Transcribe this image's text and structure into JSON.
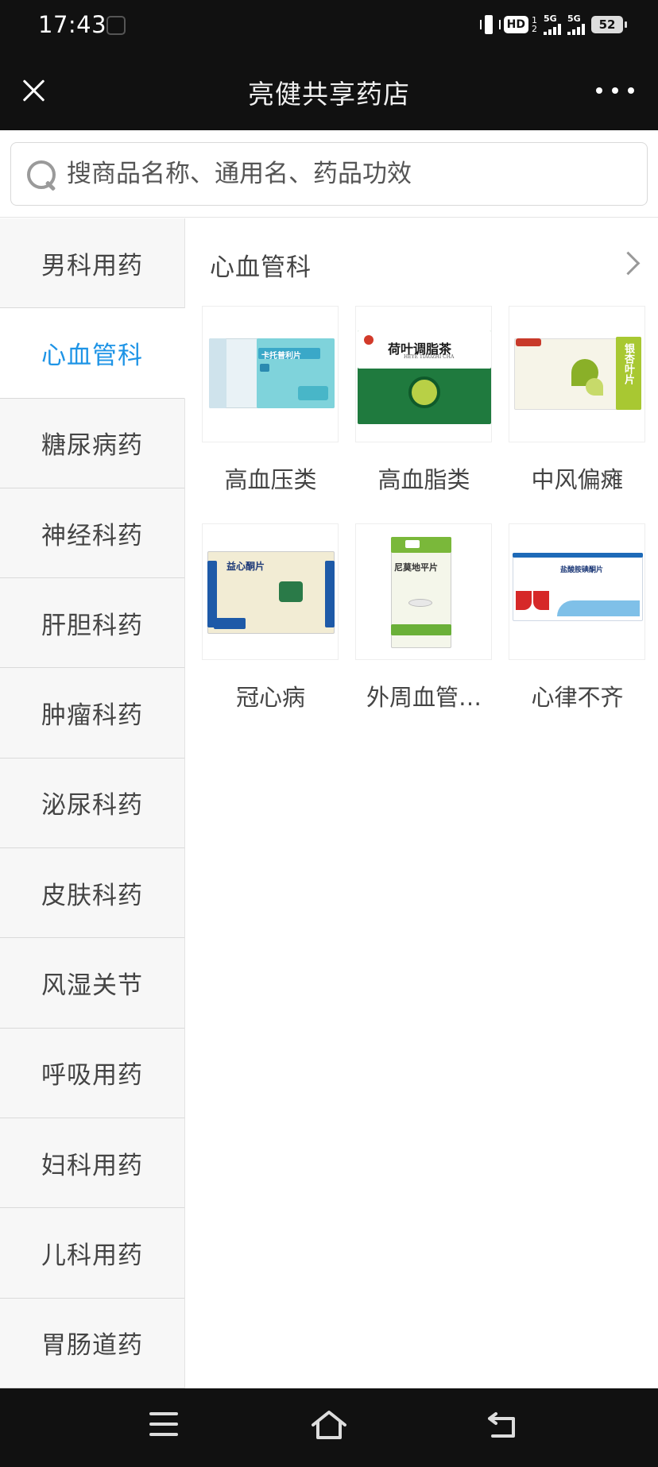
{
  "status_bar": {
    "time": "17:43",
    "hd_label": "HD",
    "hd_sup": "1",
    "hd_sub": "2",
    "sig1_label": "5G",
    "sig2_label": "5G",
    "battery": "52"
  },
  "header": {
    "title": "亮健共享药店",
    "close_icon": "close-icon",
    "more_icon": "more-icon"
  },
  "search": {
    "placeholder": "搜商品名称、通用名、药品功效"
  },
  "sidebar": {
    "items": [
      {
        "label": "男科用药"
      },
      {
        "label": "心血管科"
      },
      {
        "label": "糖尿病药"
      },
      {
        "label": "神经科药"
      },
      {
        "label": "肝胆科药"
      },
      {
        "label": "肿瘤科药"
      },
      {
        "label": "泌尿科药"
      },
      {
        "label": "皮肤科药"
      },
      {
        "label": "风湿关节"
      },
      {
        "label": "呼吸用药"
      },
      {
        "label": "妇科用药"
      },
      {
        "label": "儿科用药"
      },
      {
        "label": "胃肠道药"
      }
    ],
    "active_index": 1
  },
  "content": {
    "section_title": "心血管科",
    "categories": [
      {
        "label": "高血压类",
        "box_text": "卡托普利片"
      },
      {
        "label": "高血脂类",
        "box_text": "荷叶调脂茶",
        "box_subtext": "HEYE TIAOZHI CHA"
      },
      {
        "label": "中风偏瘫",
        "box_text": "银杏叶片"
      },
      {
        "label": "冠心病",
        "box_text": "益心酮片"
      },
      {
        "label": "外周血管…",
        "box_text": "尼莫地平片"
      },
      {
        "label": "心律不齐",
        "box_text": "盐酸胺碘酮片"
      }
    ]
  },
  "colors": {
    "accent": "#1e94e6",
    "header_bg": "#111111",
    "sidebar_bg": "#f7f7f7"
  },
  "navbar": {
    "menu_icon": "menu-icon",
    "home_icon": "home-icon",
    "back_icon": "back-icon"
  }
}
